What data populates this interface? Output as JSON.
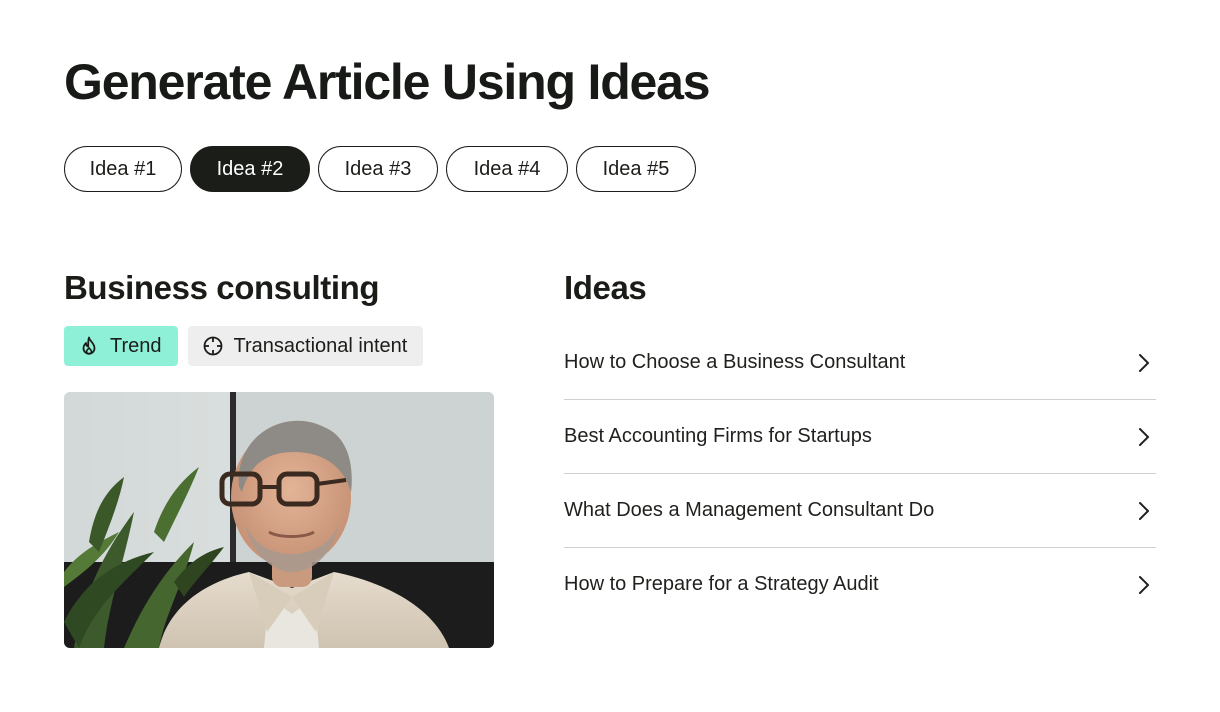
{
  "page": {
    "title": "Generate Article Using Ideas"
  },
  "tabs": [
    {
      "label": "Idea #1",
      "active": false
    },
    {
      "label": "Idea #2",
      "active": true
    },
    {
      "label": "Idea #3",
      "active": false
    },
    {
      "label": "Idea #4",
      "active": false
    },
    {
      "label": "Idea #5",
      "active": false
    }
  ],
  "topic": {
    "title": "Business consulting",
    "badges": [
      {
        "label": "Trend",
        "icon": "flame-icon",
        "color": "#8ef0d6"
      },
      {
        "label": "Transactional intent",
        "icon": "target-icon",
        "color": "#eeeeee"
      }
    ],
    "image": "portrait-photo"
  },
  "ideas": {
    "title": "Ideas",
    "items": [
      {
        "label": "How to Choose a Business Consultant",
        "icon": "chevron-right-icon"
      },
      {
        "label": "Best Accounting Firms for Startups",
        "icon": "chevron-right-icon"
      },
      {
        "label": "What Does a Management Consultant Do",
        "icon": "chevron-right-icon"
      },
      {
        "label": "How to Prepare for a Strategy Audit",
        "icon": "chevron-right-icon"
      }
    ]
  },
  "colors": {
    "text": "#1a1c18",
    "active_tab_bg": "#1a1d18",
    "trend_badge": "#8ef0d6",
    "intent_badge": "#eeeeee",
    "divider": "#cfcfcf"
  }
}
